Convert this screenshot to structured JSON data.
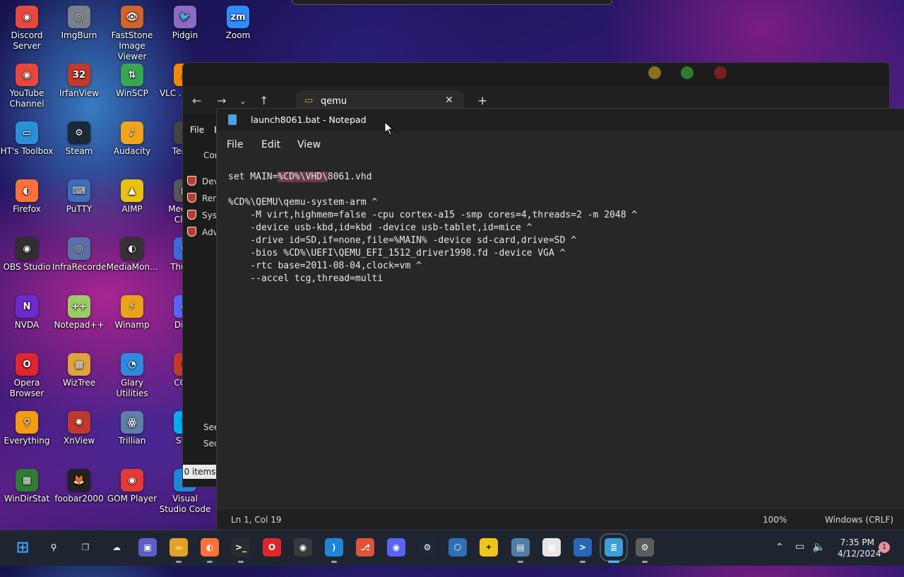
{
  "desktop_icons": [
    {
      "label": "Discord Server",
      "color": "#e6483d",
      "glyph": "◉"
    },
    {
      "label": "ImgBurn",
      "color": "#7a7f8c",
      "glyph": "◎"
    },
    {
      "label": "FastStone Image Viewer",
      "color": "#d3622b",
      "glyph": "👁"
    },
    {
      "label": "Pidgin",
      "color": "#8a6cc4",
      "glyph": "🐦"
    },
    {
      "label": "Zoom",
      "color": "#2d8cff",
      "glyph": "zm"
    },
    {
      "label": "YouTube Channel",
      "color": "#e6483d",
      "glyph": "◉"
    },
    {
      "label": "IrfanView",
      "color": "#c0392b",
      "glyph": "32"
    },
    {
      "label": "WinSCP",
      "color": "#3aa655",
      "glyph": "⇅"
    },
    {
      "label": "VLC ... pla...",
      "color": "#f08a00",
      "glyph": "▲"
    },
    {
      "label": "HT's Toolbox",
      "color": "#2b8fd6",
      "glyph": "▭"
    },
    {
      "label": "Steam",
      "color": "#1b2838",
      "glyph": "⚙"
    },
    {
      "label": "Audacity",
      "color": "#f2a51a",
      "glyph": "♪"
    },
    {
      "label": "Tera...",
      "color": "#444",
      "glyph": "▸"
    },
    {
      "label": "Firefox",
      "color": "#ff7139",
      "glyph": "◐"
    },
    {
      "label": "PuTTY",
      "color": "#3d6fb6",
      "glyph": "⌨"
    },
    {
      "label": "AIMP",
      "color": "#e8c20f",
      "glyph": "▲"
    },
    {
      "label": "Media... Cla...",
      "color": "#555",
      "glyph": "▶"
    },
    {
      "label": "OBS Studio",
      "color": "#302e31",
      "glyph": "◉"
    },
    {
      "label": "InfraRecorder",
      "color": "#5b6fa8",
      "glyph": "◎"
    },
    {
      "label": "MediaMon...",
      "color": "#333",
      "glyph": "◐"
    },
    {
      "label": "Thun...",
      "color": "#3a6bd8",
      "glyph": "✉"
    },
    {
      "label": "NVDA",
      "color": "#6a2bd0",
      "glyph": "N"
    },
    {
      "label": "Notepad++",
      "color": "#9ccc65",
      "glyph": "++"
    },
    {
      "label": "Winamp",
      "color": "#e8a31a",
      "glyph": "⚡"
    },
    {
      "label": "Dis...",
      "color": "#5865f2",
      "glyph": "◉"
    },
    {
      "label": "Opera Browser",
      "color": "#e0262c",
      "glyph": "O"
    },
    {
      "label": "WizTree",
      "color": "#e2a23a",
      "glyph": "▦"
    },
    {
      "label": "Glary Utilities",
      "color": "#2f89e0",
      "glyph": "◔"
    },
    {
      "label": "CCl...",
      "color": "#c0392b",
      "glyph": "C"
    },
    {
      "label": "Everything",
      "color": "#f39c12",
      "glyph": "⚲"
    },
    {
      "label": "XnView",
      "color": "#c0392b",
      "glyph": "✺"
    },
    {
      "label": "Trillian",
      "color": "#5f7fa8",
      "glyph": "ꙮ"
    },
    {
      "label": "Sk...",
      "color": "#00aff0",
      "glyph": "S"
    },
    {
      "label": "WinDirStat",
      "color": "#2e7d32",
      "glyph": "▦"
    },
    {
      "label": "foobar2000",
      "color": "#222",
      "glyph": "🦊"
    },
    {
      "label": "GOM Player",
      "color": "#e53935",
      "glyph": "◉"
    },
    {
      "label": "Visual Studio Code",
      "color": "#1f86d6",
      "glyph": "⟩"
    }
  ],
  "explorer": {
    "tab_title": "qemu",
    "menu_file": "File",
    "menu_partial": "E",
    "content_heading_partial": "Cor",
    "left_rows": [
      "Dev",
      "Ren",
      "Syst",
      "Adv"
    ],
    "lower_rows": [
      "See",
      "Sec"
    ],
    "status": "0 items"
  },
  "notepad": {
    "title": "launch8061.bat - Notepad",
    "menu": [
      "File",
      "Edit",
      "View"
    ],
    "lines": [
      {
        "pre": "set MAIN=",
        "sel": "%CD%\\VHD\\",
        "post": "8061.vhd"
      },
      {
        "pre": "",
        "sel": "",
        "post": ""
      },
      {
        "pre": "%CD%\\QEMU\\qemu-system-arm ^",
        "sel": "",
        "post": ""
      },
      {
        "pre": "    -M virt,highmem=false -cpu cortex-a15 -smp cores=4,threads=2 -m 2048 ^",
        "sel": "",
        "post": ""
      },
      {
        "pre": "    -device usb-kbd,id=kbd -device usb-tablet,id=mice ^",
        "sel": "",
        "post": ""
      },
      {
        "pre": "    -drive id=SD,if=none,file=%MAIN% -device sd-card,drive=SD ^",
        "sel": "",
        "post": ""
      },
      {
        "pre": "    -bios %CD%\\UEFI\\QEMU_EFI_1512_driver1998.fd -device VGA ^",
        "sel": "",
        "post": ""
      },
      {
        "pre": "    -rtc base=2011-08-04,clock=vm ^",
        "sel": "",
        "post": ""
      },
      {
        "pre": "    --accel tcg,thread=multi",
        "sel": "",
        "post": ""
      }
    ],
    "status": {
      "position": "Ln 1, Col 19",
      "zoom": "100%",
      "line_ending": "Windows (CRLF)"
    }
  },
  "taskbar": {
    "apps": [
      {
        "name": "start-button",
        "glyph": "⊞",
        "color": "#3aa0ff",
        "bg": "transparent"
      },
      {
        "name": "search-icon",
        "glyph": "⚲",
        "color": "#ffffff",
        "bg": "transparent"
      },
      {
        "name": "task-view-icon",
        "glyph": "❐",
        "color": "#d0d0d0",
        "bg": "transparent"
      },
      {
        "name": "weather-icon",
        "glyph": "☁",
        "color": "#dfe6ee",
        "bg": "transparent"
      },
      {
        "name": "teams-icon",
        "glyph": "▣",
        "color": "#ffffff",
        "bg": "#5b5fc7"
      },
      {
        "name": "file-explorer-icon",
        "glyph": "▬",
        "color": "#f7c948",
        "bg": "#e0a32a"
      },
      {
        "name": "firefox-icon",
        "glyph": "◐",
        "color": "#ffffff",
        "bg": "#ff7139"
      },
      {
        "name": "terminal-icon",
        "glyph": ">_",
        "color": "#ffffff",
        "bg": "#2b2b2b"
      },
      {
        "name": "opera-icon",
        "glyph": "O",
        "color": "#ffffff",
        "bg": "#e0262c"
      },
      {
        "name": "obs-icon",
        "glyph": "◉",
        "color": "#ffffff",
        "bg": "#3a3a3a"
      },
      {
        "name": "vscode-icon",
        "glyph": "⟩",
        "color": "#ffffff",
        "bg": "#1f86d6"
      },
      {
        "name": "git-icon",
        "glyph": "⎇",
        "color": "#ffffff",
        "bg": "#e0523a"
      },
      {
        "name": "discord-icon",
        "glyph": "◉",
        "color": "#ffffff",
        "bg": "#5865f2"
      },
      {
        "name": "steam-icon",
        "glyph": "⚙",
        "color": "#ffffff",
        "bg": "#1b2838"
      },
      {
        "name": "virtualbox-icon",
        "glyph": "⬡",
        "color": "#ffffff",
        "bg": "#2f6fb5"
      },
      {
        "name": "jdownloader-icon",
        "glyph": "✦",
        "color": "#3a2f00",
        "bg": "#f0c419"
      },
      {
        "name": "resource-monitor-icon",
        "glyph": "▤",
        "color": "#ffffff",
        "bg": "#4f7ea8"
      },
      {
        "name": "store-icon",
        "glyph": "▦",
        "color": "#ffffff",
        "bg": "#e6e6e6"
      },
      {
        "name": "powershell-icon",
        "glyph": ">",
        "color": "#ffffff",
        "bg": "#2a66b8"
      },
      {
        "name": "notepad-icon",
        "glyph": "≣",
        "color": "#ffffff",
        "bg": "#3aa0d8"
      },
      {
        "name": "settings-icon",
        "glyph": "⚙",
        "color": "#ffffff",
        "bg": "#5c5c5c"
      }
    ],
    "time": "7:35 PM",
    "date": "4/12/2024",
    "notification_count": "1"
  }
}
